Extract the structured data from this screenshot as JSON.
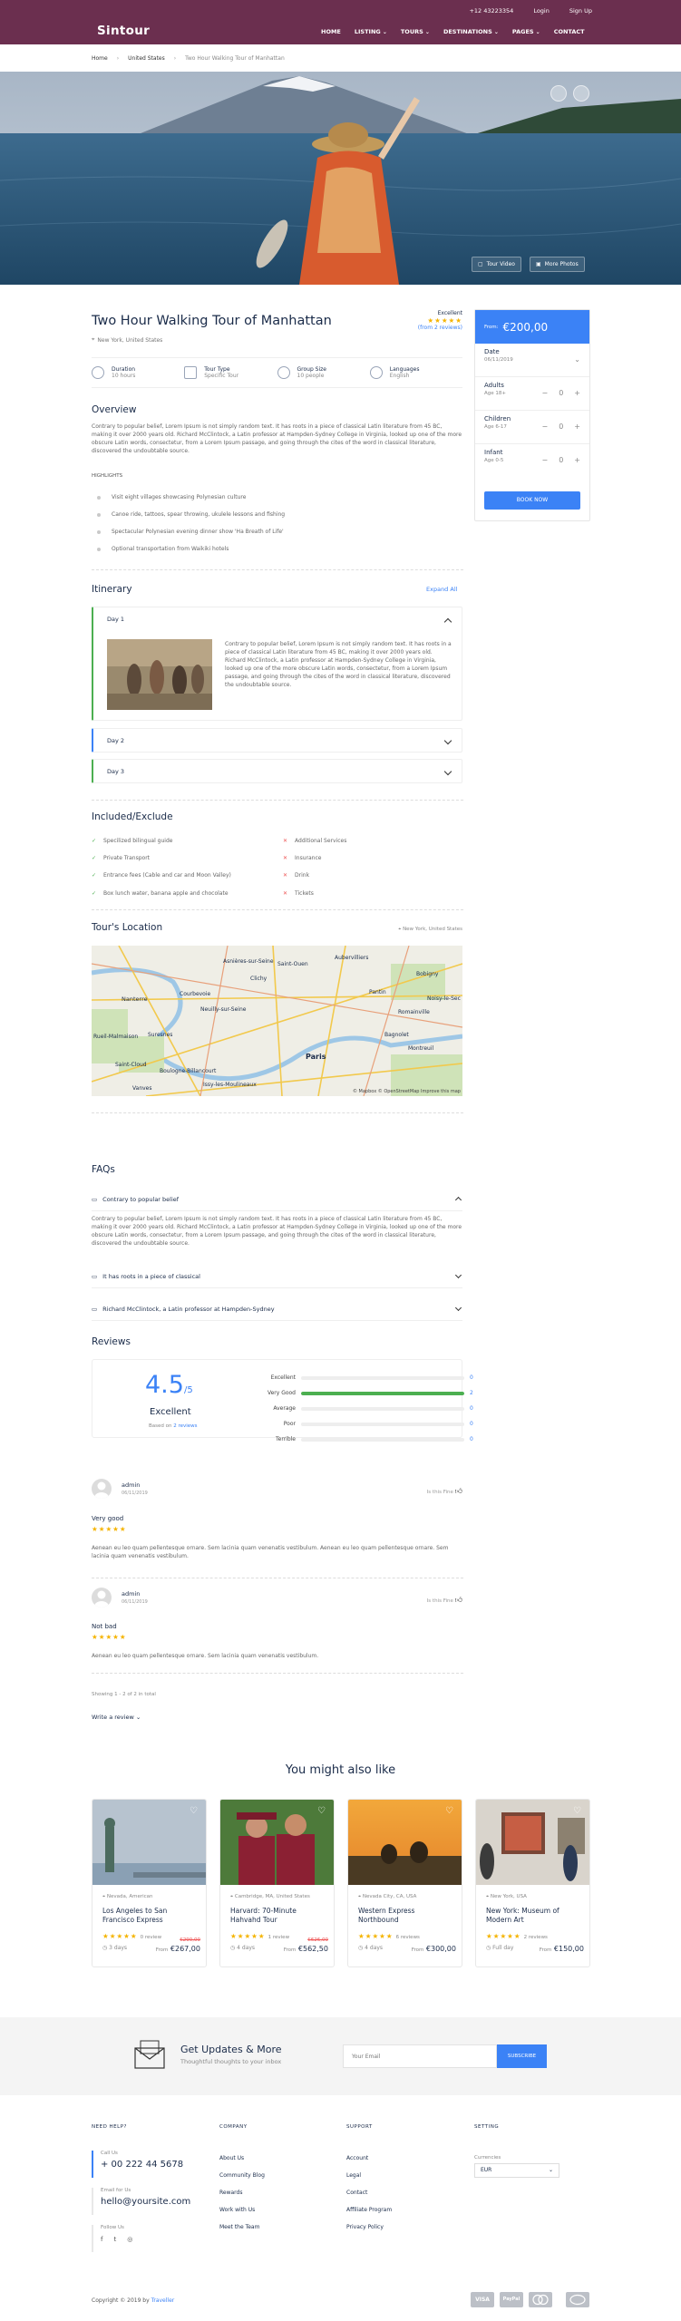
{
  "header": {
    "logo": "Sintour",
    "phone": "+12 43223354",
    "login": "Login",
    "signup": "Sign Up",
    "nav": [
      "HOME",
      "LISTING",
      "TOURS",
      "DESTINATIONS",
      "PAGES",
      "CONTACT"
    ]
  },
  "breadcrumb": [
    "Home",
    "United States",
    "Two Hour Walking Tour of Manhattan"
  ],
  "hero": {
    "video_label": "Tour Video",
    "photos_label": "More Photos"
  },
  "tour": {
    "title": "Two Hour Walking Tour of Manhattan",
    "location": "New York, United States",
    "rating_word": "Excellent",
    "reviews_link": "(from 2 reviews)",
    "facts": [
      {
        "label": "Duration",
        "value": "10 hours"
      },
      {
        "label": "Tour Type",
        "value": "Specific Tour"
      },
      {
        "label": "Group Size",
        "value": "10 people"
      },
      {
        "label": "Languages",
        "value": "English"
      }
    ]
  },
  "overview": {
    "heading": "Overview",
    "text": "Contrary to popular belief, Lorem Ipsum is not simply random text. It has roots in a piece of classical Latin literature from 45 BC, making it over 2000 years old. Richard McClintock, a Latin professor at Hampden-Sydney College in Virginia, looked up one of the more obscure Latin words, consectetur, from a Lorem Ipsum passage, and going through the cites of the word in classical literature, discovered the undoubtable source.",
    "highlights_heading": "HIGHLIGHTS",
    "highlights": [
      "Visit eight villages showcasing Polynesian culture",
      "Canoe ride, tattoos, spear throwing, ukulele lessons and fishing",
      "Spectacular Polynesian evening dinner show 'Ha Breath of Life'",
      "Optional transportation from Waikiki hotels"
    ]
  },
  "booking": {
    "from": "From:",
    "price": "€200,00",
    "date_label": "Date",
    "date_value": "06/11/2019",
    "adults_label": "Adults",
    "adults_age": "Age 18+",
    "children_label": "Children",
    "children_age": "Age 6-17",
    "infant_label": "Infant",
    "infant_age": "Age 0-5",
    "adults_qty": "0",
    "children_qty": "0",
    "infant_qty": "0",
    "button": "BOOK NOW"
  },
  "itinerary": {
    "heading": "Itinerary",
    "expand": "Expand All",
    "days": [
      "Day 1",
      "Day 2",
      "Day 3"
    ],
    "day1_text": "Contrary to popular belief, Lorem Ipsum is not simply random text. It has roots in a piece of classical Latin literature from 45 BC, making it over 2000 years old. Richard McClintock, a Latin professor at Hampden-Sydney College in Virginia, looked up one of the more obscure Latin words, consectetur, from a Lorem Ipsum passage, and going through the cites of the word in classical literature, discovered the undoubtable source."
  },
  "included": {
    "heading": "Included/Exclude",
    "yes": [
      "Specilized bilingual guide",
      "Private Transport",
      "Entrance fees (Cable and car and Moon Valley)",
      "Box lunch water, banana apple and chocolate"
    ],
    "no": [
      "Additional Services",
      "Insurance",
      "Drink",
      "Tickets"
    ]
  },
  "location": {
    "heading": "Tour's Location",
    "address": "New York, United States",
    "map_labels": [
      "Asnières-sur-Seine",
      "Saint-Ouen",
      "Aubervilliers",
      "Clichy",
      "Bobigny",
      "Nanterre",
      "Courbevoie",
      "Pantin",
      "Noisy-le-Sec",
      "Neuilly-sur-Seine",
      "Romainville",
      "Suresnes",
      "Bagnolet",
      "Rueil-Malmaison",
      "Montreuil",
      "Paris",
      "Saint-Cloud",
      "Boulogne-Billancourt",
      "Issy-les-Moulineaux",
      "Vanves"
    ],
    "attribution": "© Mapbox © OpenStreetMap Improve this map"
  },
  "faqs": {
    "heading": "FAQs",
    "items": [
      "Contrary to popular belief",
      "It has roots in a piece of classical",
      "Richard McClintock, a Latin professor at Hampden-Sydney"
    ],
    "answer": "Contrary to popular belief, Lorem Ipsum is not simply random text. It has roots in a piece of classical Latin literature from 45 BC, making it over 2000 years old. Richard McClintock, a Latin professor at Hampden-Sydney College in Virginia, looked up one of the more obscure Latin words, consectetur, from a Lorem Ipsum passage, and going through the cites of the word in classical literature, discovered the undoubtable source."
  },
  "reviews": {
    "heading": "Reviews",
    "score": "4.5",
    "out_of": "/5",
    "word": "Excellent",
    "based_prefix": "Based on ",
    "based_link": "2 reviews",
    "breakdown": [
      {
        "label": "Excellent",
        "count": "0",
        "fraction": 0
      },
      {
        "label": "Very Good",
        "count": "2",
        "fraction": 1
      },
      {
        "label": "Average",
        "count": "0",
        "fraction": 0
      },
      {
        "label": "Poor",
        "count": "0",
        "fraction": 0
      },
      {
        "label": "Terrible",
        "count": "0",
        "fraction": 0
      }
    ],
    "items": [
      {
        "author": "admin",
        "date": "06/11/2019",
        "helpful": "Is this Fine",
        "title": "Very good",
        "stars": "★★★★★",
        "text": "Aenean eu leo quam pellentesque ornare. Sem lacinia quam venenatis vestibulum. Aenean eu leo quam pellentesque ornare. Sem lacinia quam venenatis vestibulum."
      },
      {
        "author": "admin",
        "date": "06/11/2019",
        "helpful": "Is this Fine",
        "title": "Not bad",
        "stars": "★★★★★",
        "text": "Aenean eu leo quam pellentesque ornare. Sem lacinia quam venenatis vestibulum."
      }
    ],
    "showing": "Showing 1 - 2 of 2 in total",
    "write": "Write a review"
  },
  "related": {
    "heading": "You might also like",
    "cards": [
      {
        "location": "Nevada, American",
        "title": "Los Angeles to San Francisco Express",
        "stars": "★★★★★",
        "reviews": "0 review",
        "duration": "3 days",
        "old_price": "€290,00",
        "from": "From",
        "price": "€267,00"
      },
      {
        "location": "Cambridge, MA, United States",
        "title": "Harvard: 70-Minute Hahvahd Tour",
        "stars": "★★★★★",
        "reviews": "1 review",
        "duration": "4 days",
        "old_price": "€626,00",
        "from": "From",
        "price": "€562,50"
      },
      {
        "location": "Nevada City, CA, USA",
        "title": "Western Express Northbound",
        "stars": "★★★★★",
        "reviews": "6 reviews",
        "duration": "4 days",
        "old_price": "",
        "from": "From",
        "price": "€300,00"
      },
      {
        "location": "New York, USA",
        "title": "New York: Museum of Modern Art",
        "stars": "★★★★★",
        "reviews": "2 reviews",
        "duration": "Full day",
        "old_price": "",
        "from": "From",
        "price": "€150,00"
      }
    ]
  },
  "newsletter": {
    "title": "Get Updates & More",
    "subtitle": "Thoughtful thoughts to your inbox",
    "placeholder": "Your Email",
    "button": "SUBSCRIBE"
  },
  "footer": {
    "need_help": "NEED HELP?",
    "call_label": "Call Us",
    "phone": "+ 00 222 44 5678",
    "email_label": "Email for Us",
    "email": "hello@yoursite.com",
    "follow_label": "Follow Us",
    "company_heading": "COMPANY",
    "company": [
      "About Us",
      "Community Blog",
      "Rewards",
      "Work with Us",
      "Meet the Team"
    ],
    "support_heading": "SUPPORT",
    "support": [
      "Account",
      "Legal",
      "Contact",
      "Affiliate Program",
      "Privacy Policy"
    ],
    "setting_heading": "SETTING",
    "currencies_label": "Currencies",
    "currency": "EUR",
    "copyright_prefix": "Copyright © 2019 by ",
    "copyright_brand": "Traveller",
    "payments": [
      "VISA",
      "PayPal",
      "",
      ""
    ]
  },
  "colors": {
    "header": "#6b2f4f",
    "accent": "#3b82f6",
    "green": "#4caf50",
    "star": "#f5b400"
  }
}
